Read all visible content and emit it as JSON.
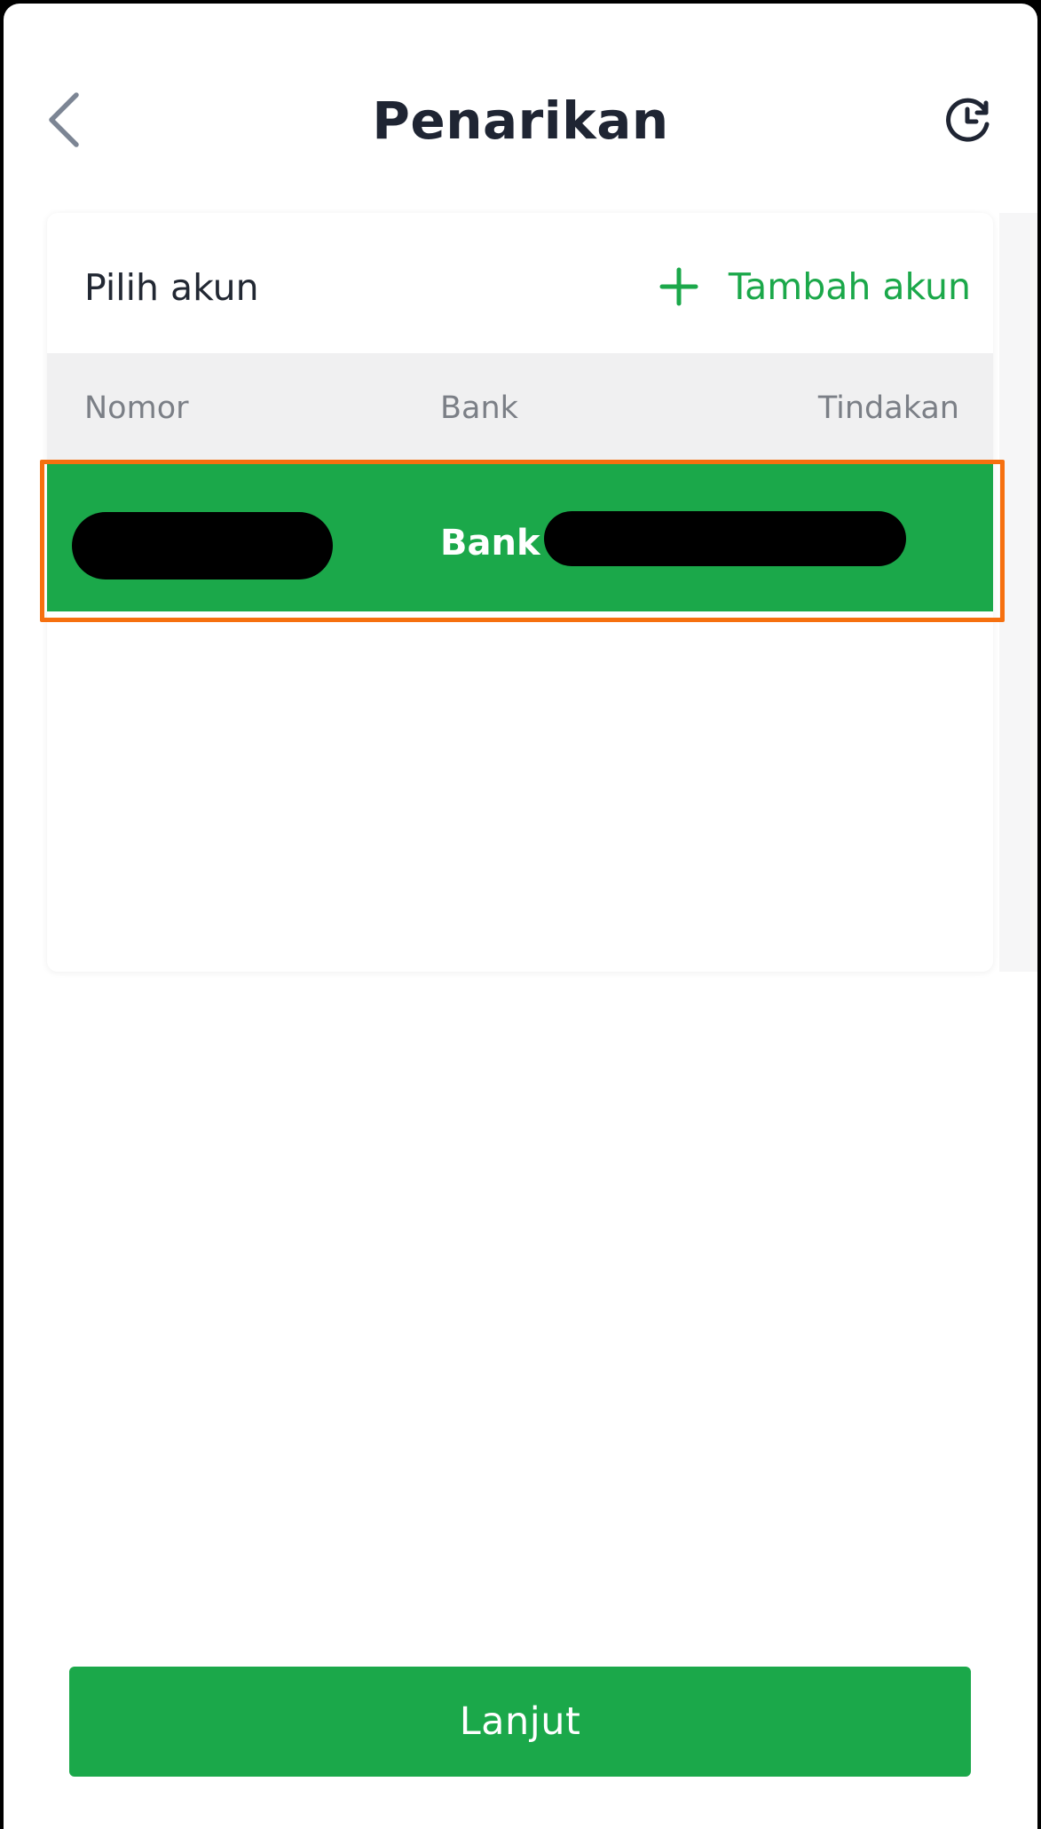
{
  "header": {
    "title": "Penarikan",
    "back_icon": "chevron-left-icon",
    "history_icon": "history-clock-icon"
  },
  "account_card": {
    "label": "Pilih akun",
    "add_account_label": "Tambah akun",
    "add_icon": "plus-icon",
    "columns": [
      "Nomor",
      "Bank",
      "Tindakan"
    ],
    "rows": [
      {
        "bank_prefix": "Bank",
        "number_redacted": true,
        "bank_name_redacted": true
      }
    ]
  },
  "footer": {
    "continue_label": "Lanjut"
  },
  "colors": {
    "brand_green": "#1ba84a",
    "title_text": "#1f2533",
    "highlight_frame": "#f6700f",
    "table_header_bg": "#f0f0f1"
  }
}
